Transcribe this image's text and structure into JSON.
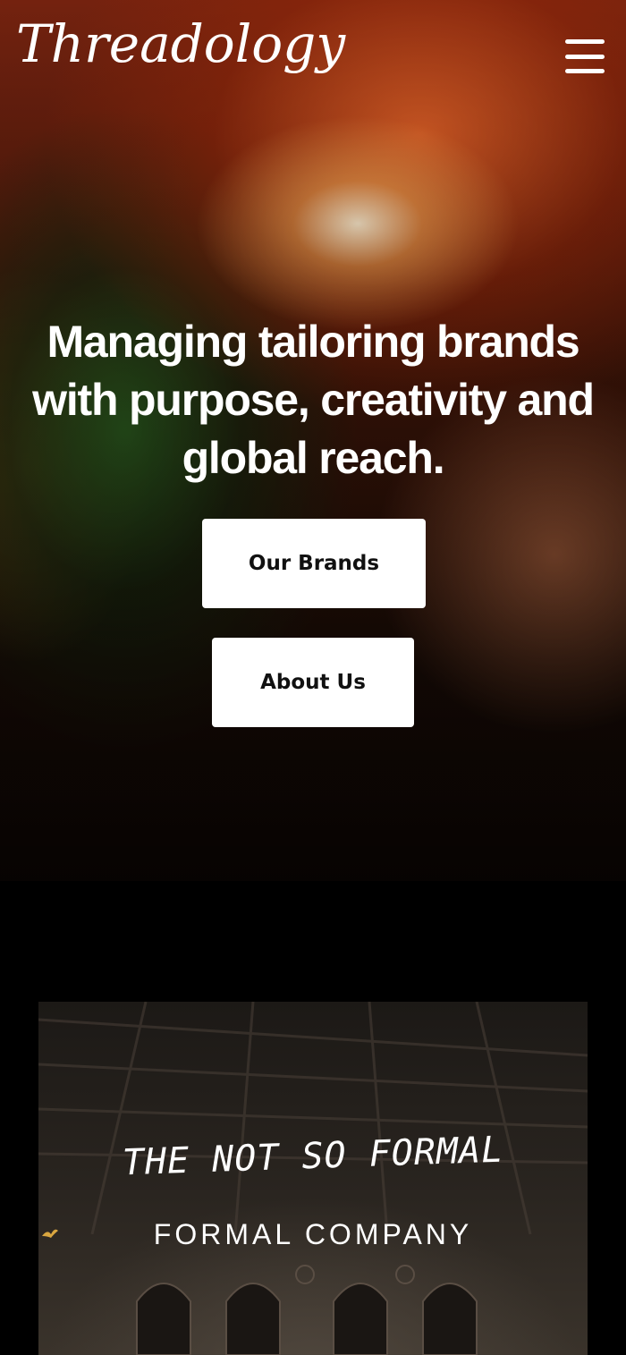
{
  "header": {
    "logo_text": "Threadology",
    "menu_icon": "hamburger-menu-icon"
  },
  "hero": {
    "headline": "Managing tailoring brands with purpose, creativity and global reach.",
    "buttons": {
      "our_brands": "Our Brands",
      "about_us": "About Us"
    }
  },
  "feature": {
    "tagline": "THE NOT SO FORMAL",
    "company": "FORMAL COMPANY"
  },
  "colors": {
    "background": "#000000",
    "button_bg": "#ffffff",
    "button_text": "#111111",
    "text": "#ffffff"
  }
}
